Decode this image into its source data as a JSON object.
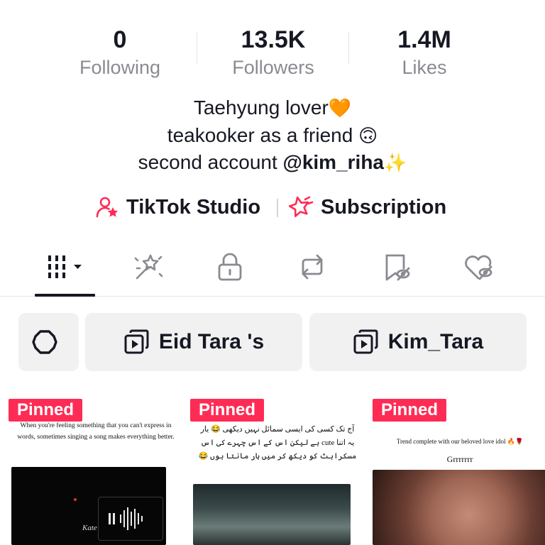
{
  "stats": [
    {
      "value": "0",
      "label": "Following"
    },
    {
      "value": "13.5K",
      "label": "Followers"
    },
    {
      "value": "1.4M",
      "label": "Likes"
    }
  ],
  "bio": {
    "line1_text": "Taehyung lover",
    "line1_emoji": "🧡",
    "line2_text": "teakooker as a friend ",
    "line2_emoji": "🙃",
    "line3_text": "second account ",
    "line3_mention": "@kim_riha",
    "line3_emoji": "✨"
  },
  "links": {
    "studio_label": "TikTok Studio",
    "subscription_label": "Subscription"
  },
  "tabs": [
    {
      "icon": "grid-icon",
      "active": true
    },
    {
      "icon": "sparkle-wand-icon"
    },
    {
      "icon": "lock-icon"
    },
    {
      "icon": "repost-icon"
    },
    {
      "icon": "favorites-icon"
    },
    {
      "icon": "liked-icon"
    }
  ],
  "chips": {
    "gear_icon": "gear-icon",
    "playlist1_label": "Eid Tara 's",
    "playlist2_label": "Kim_Tara"
  },
  "videos": [
    {
      "pinned_label": "Pinned",
      "caption": "When you're feeling something that you can't express in words, sometimes singing a song makes everything better.",
      "watermark": "Kate"
    },
    {
      "pinned_label": "Pinned",
      "caption": "آج تک کسی کی ایسی سمائل نہیں دیکھی 😂 یار یہ اتنا cute ہے لیکن اس کے اس چہرے کی اس مسکراہٹ کو دیکھ کر میں ہار مانتا ہوں 😂"
    },
    {
      "pinned_label": "Pinned",
      "caption": "Trend complete with our beloved love idol 🔥🌹",
      "sub_caption": "Grrrrrrr"
    }
  ],
  "colors": {
    "accent": "#fe2c55",
    "text": "#161823",
    "muted": "#8a8b91",
    "chip_bg": "#f1f1f2"
  }
}
